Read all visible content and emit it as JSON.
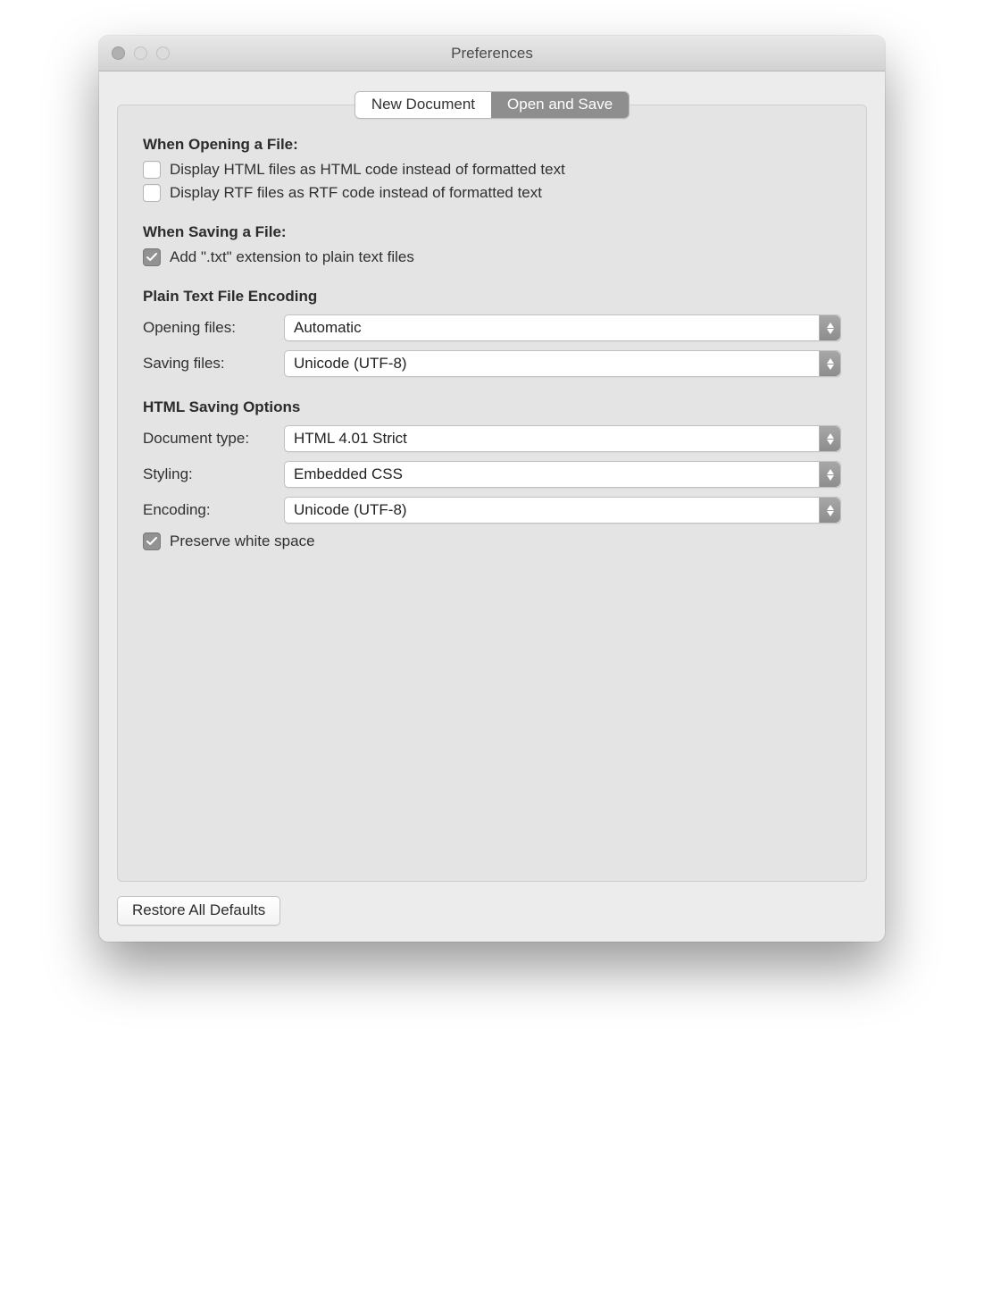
{
  "window": {
    "title": "Preferences"
  },
  "tabs": {
    "new_document": "New Document",
    "open_and_save": "Open and Save",
    "active": "open_and_save"
  },
  "sections": {
    "opening": {
      "heading": "When Opening a File:",
      "display_html_label": "Display HTML files as HTML code instead of formatted text",
      "display_html_checked": false,
      "display_rtf_label": "Display RTF files as RTF code instead of formatted text",
      "display_rtf_checked": false
    },
    "saving": {
      "heading": "When Saving a File:",
      "add_txt_label": "Add \".txt\" extension to plain text files",
      "add_txt_checked": true
    },
    "encoding": {
      "heading": "Plain Text File Encoding",
      "opening_label": "Opening files:",
      "opening_value": "Automatic",
      "saving_label": "Saving files:",
      "saving_value": "Unicode (UTF-8)"
    },
    "html": {
      "heading": "HTML Saving Options",
      "doc_type_label": "Document type:",
      "doc_type_value": "HTML 4.01 Strict",
      "styling_label": "Styling:",
      "styling_value": "Embedded CSS",
      "encoding_label": "Encoding:",
      "encoding_value": "Unicode (UTF-8)",
      "preserve_ws_label": "Preserve white space",
      "preserve_ws_checked": true
    }
  },
  "footer": {
    "restore_button": "Restore All Defaults"
  }
}
